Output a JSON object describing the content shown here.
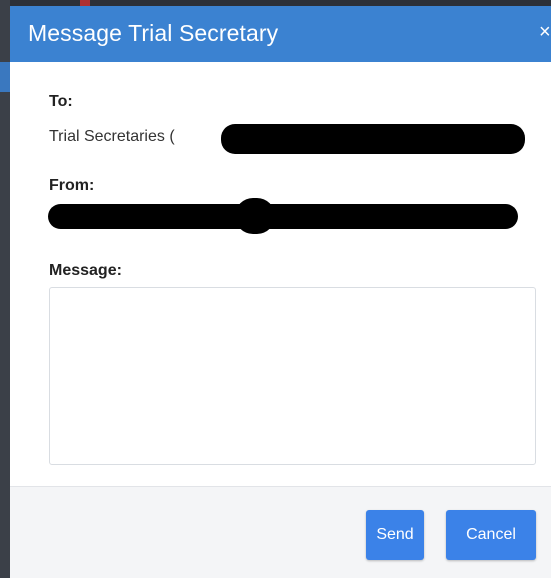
{
  "dialog": {
    "title": "Message Trial Secretary",
    "close_glyph": "×"
  },
  "to": {
    "label": "To:",
    "value_prefix": "Trial Secretaries ("
  },
  "from": {
    "label": "From:"
  },
  "message": {
    "label": "Message:",
    "value": ""
  },
  "footer": {
    "send_label": "Send",
    "cancel_label": "Cancel"
  },
  "colors": {
    "header_bg": "#3b82d1",
    "button_bg": "#3b82e8",
    "footer_bg": "#f4f5f7"
  }
}
